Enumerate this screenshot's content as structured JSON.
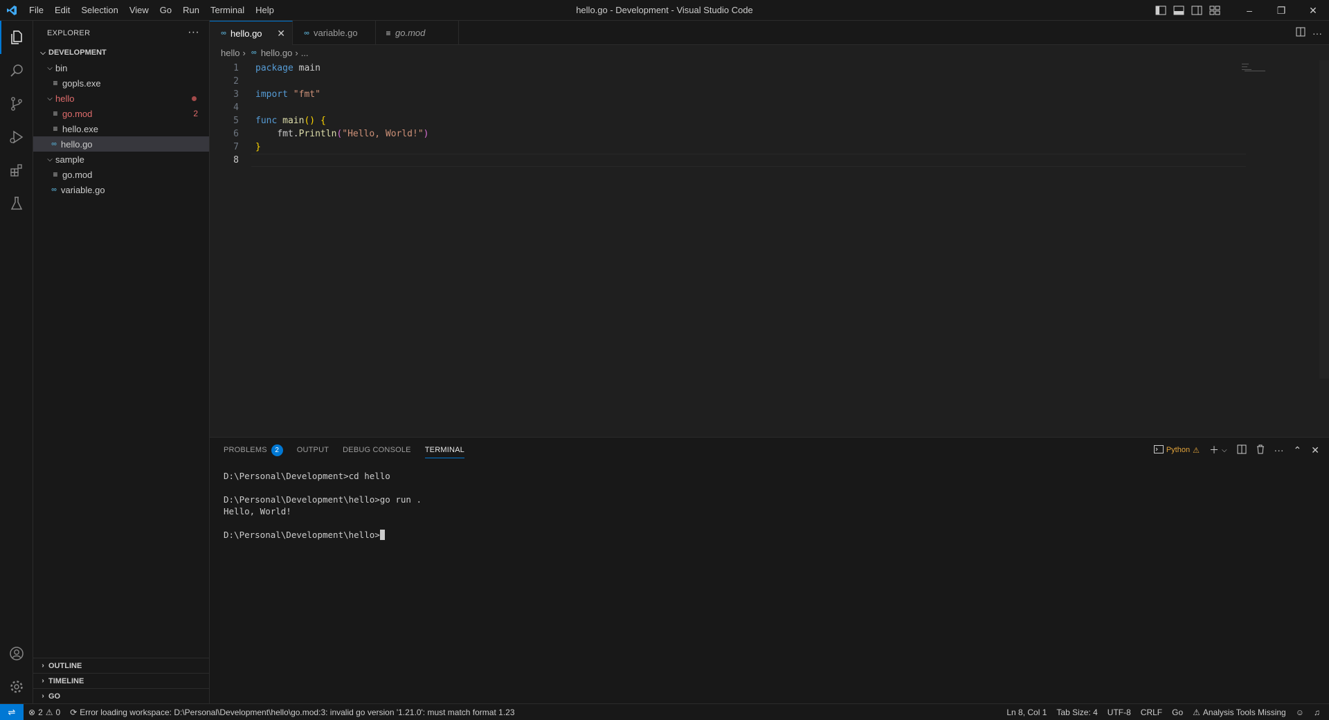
{
  "titlebar": {
    "menu": [
      "File",
      "Edit",
      "Selection",
      "View",
      "Go",
      "Run",
      "Terminal",
      "Help"
    ],
    "title": "hello.go - Development - Visual Studio Code",
    "window_buttons": {
      "minimize": "–",
      "restore": "❐",
      "close": "✕"
    }
  },
  "sidebar": {
    "header": "EXPLORER",
    "more": "···",
    "root": "DEVELOPMENT",
    "tree": [
      {
        "label": "bin",
        "type": "folder",
        "depth": 1
      },
      {
        "label": "gopls.exe",
        "type": "file",
        "depth": 2
      },
      {
        "label": "hello",
        "type": "folder",
        "depth": 1,
        "error": true
      },
      {
        "label": "go.mod",
        "type": "file",
        "depth": 2,
        "error": true,
        "badge": "2"
      },
      {
        "label": "hello.exe",
        "type": "file",
        "depth": 2
      },
      {
        "label": "hello.go",
        "type": "go",
        "depth": 2,
        "selected": true
      },
      {
        "label": "sample",
        "type": "folder",
        "depth": 1
      },
      {
        "label": "go.mod",
        "type": "file",
        "depth": 2
      },
      {
        "label": "variable.go",
        "type": "go",
        "depth": 1
      }
    ],
    "sections": [
      "OUTLINE",
      "TIMELINE",
      "GO"
    ]
  },
  "editor": {
    "tabs": [
      {
        "label": "hello.go",
        "active": true
      },
      {
        "label": "variable.go",
        "active": false
      },
      {
        "label": "go.mod",
        "active": false,
        "italic": true
      }
    ],
    "breadcrumb": [
      "hello",
      "hello.go",
      "..."
    ],
    "line_numbers": [
      "1",
      "2",
      "3",
      "4",
      "5",
      "6",
      "7",
      "8"
    ],
    "code": {
      "l1_kw": "package",
      "l1_rest": " main",
      "l3_kw": "import",
      "l3_str": "\"fmt\"",
      "l5_kw": "func",
      "l5_fn": "main",
      "l5_paren": "()",
      "l5_brace": "{",
      "l6_obj": "fmt.",
      "l6_fn": "Println",
      "l6_open": "(",
      "l6_str": "\"Hello, World!\"",
      "l6_close": ")",
      "l7_brace": "}"
    }
  },
  "panel": {
    "tabs": [
      "PROBLEMS",
      "OUTPUT",
      "DEBUG CONSOLE",
      "TERMINAL"
    ],
    "problems_count": "2",
    "terminal_profile": "Python",
    "terminal_lines": [
      "D:\\Personal\\Development>cd hello",
      "",
      "D:\\Personal\\Development\\hello>go run .",
      "Hello, World!",
      "",
      "D:\\Personal\\Development\\hello>"
    ]
  },
  "statusbar": {
    "errors": "2",
    "warnings": "0",
    "message": "Error loading workspace: D:\\Personal\\Development\\hello\\go.mod:3: invalid go version '1.21.0': must match format 1.23",
    "position": "Ln 8, Col 1",
    "tab_size": "Tab Size: 4",
    "encoding": "UTF-8",
    "eol": "CRLF",
    "language": "Go",
    "analysis": "Analysis Tools Missing"
  }
}
